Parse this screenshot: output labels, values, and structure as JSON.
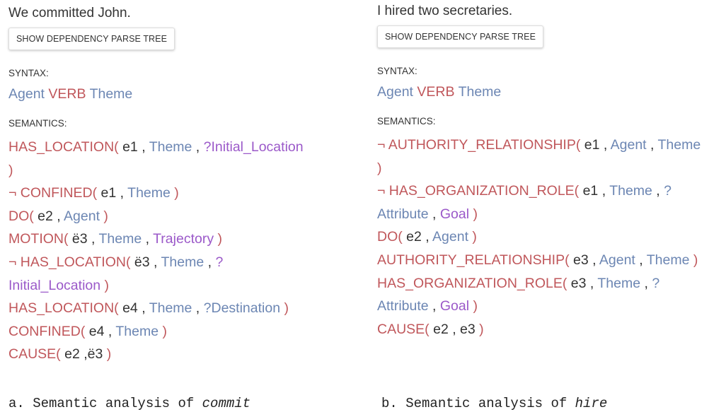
{
  "panels": [
    {
      "sentence": "We committed John.",
      "button_label": "SHOW DEPENDENCY PARSE TREE",
      "syntax_label": "SYNTAX:",
      "semantics_label": "SEMANTICS:"
    },
    {
      "sentence": "I hired two secretaries.",
      "button_label": "SHOW DEPENDENCY PARSE TREE",
      "syntax_label": "SYNTAX:",
      "semantics_label": "SEMANTICS:"
    }
  ],
  "syntax_tokens": [
    "Agent",
    "VERB",
    "Theme"
  ],
  "captions": [
    {
      "prefix": "a. Semantic analysis of ",
      "word": "commit"
    },
    {
      "prefix": "b. Semantic analysis of ",
      "word": "hire"
    }
  ],
  "semantics": [
    [
      [
        [
          "c-pred",
          "HAS_LOCATION("
        ],
        [
          "c-arg",
          " e1"
        ],
        [
          "c-arg",
          " ,"
        ],
        [
          "c-role",
          " Theme"
        ],
        [
          "c-arg",
          " ,"
        ],
        [
          "c-q",
          " ?Initial_Location"
        ]
      ],
      [
        [
          "c-paren",
          ")"
        ]
      ],
      [
        [
          "c-pred",
          "¬ CONFINED("
        ],
        [
          "c-arg",
          " e1"
        ],
        [
          "c-arg",
          " ,"
        ],
        [
          "c-role",
          " Theme"
        ],
        [
          "c-paren",
          " )"
        ]
      ],
      [
        [
          "c-pred",
          "DO("
        ],
        [
          "c-arg",
          " e2"
        ],
        [
          "c-arg",
          " ,"
        ],
        [
          "c-role",
          " Agent"
        ],
        [
          "c-paren",
          " )"
        ]
      ],
      [
        [
          "c-pred",
          "MOTION("
        ],
        [
          "c-arg",
          " ë3"
        ],
        [
          "c-arg",
          " ,"
        ],
        [
          "c-role",
          " Theme"
        ],
        [
          "c-arg",
          " ,"
        ],
        [
          "c-q",
          " Trajectory"
        ],
        [
          "c-paren",
          " )"
        ]
      ],
      [
        [
          "c-pred",
          "¬ HAS_LOCATION("
        ],
        [
          "c-arg",
          " ë3"
        ],
        [
          "c-arg",
          " ,"
        ],
        [
          "c-role",
          " Theme"
        ],
        [
          "c-arg",
          " ,"
        ],
        [
          "c-q",
          " ?"
        ]
      ],
      [
        [
          "c-q",
          "Initial_Location"
        ],
        [
          "c-paren",
          " )"
        ]
      ],
      [
        [
          "c-pred",
          "HAS_LOCATION("
        ],
        [
          "c-arg",
          " e4"
        ],
        [
          "c-arg",
          " ,"
        ],
        [
          "c-role",
          " Theme"
        ],
        [
          "c-arg",
          " ,"
        ],
        [
          "c-role",
          " ?Destination"
        ],
        [
          "c-paren",
          " )"
        ]
      ],
      [
        [
          "c-pred",
          "CONFINED("
        ],
        [
          "c-arg",
          " e4"
        ],
        [
          "c-arg",
          " ,"
        ],
        [
          "c-role",
          " Theme"
        ],
        [
          "c-paren",
          " )"
        ]
      ],
      [
        [
          "c-pred",
          "CAUSE("
        ],
        [
          "c-arg",
          " e2"
        ],
        [
          "c-arg",
          " ,"
        ],
        [
          "c-arg",
          "ë3"
        ],
        [
          "c-paren",
          " )"
        ]
      ]
    ],
    [
      [
        [
          "c-pred",
          "¬ AUTHORITY_RELATIONSHIP("
        ],
        [
          "c-arg",
          " e1"
        ],
        [
          "c-arg",
          " ,"
        ],
        [
          "c-role",
          " Agent"
        ],
        [
          "c-arg",
          " ,"
        ],
        [
          "c-role",
          " Theme"
        ]
      ],
      [
        [
          "c-paren",
          ")"
        ]
      ],
      [
        [
          "c-pred",
          "¬ HAS_ORGANIZATION_ROLE("
        ],
        [
          "c-arg",
          " e1"
        ],
        [
          "c-arg",
          " ,"
        ],
        [
          "c-role",
          " Theme"
        ],
        [
          "c-arg",
          " ,"
        ],
        [
          "c-role",
          " ?"
        ]
      ],
      [
        [
          "c-role",
          "Attribute"
        ],
        [
          "c-arg",
          " ,"
        ],
        [
          "c-q",
          " Goal"
        ],
        [
          "c-paren",
          " )"
        ]
      ],
      [
        [
          "c-pred",
          "DO("
        ],
        [
          "c-arg",
          " e2"
        ],
        [
          "c-arg",
          " ,"
        ],
        [
          "c-role",
          " Agent"
        ],
        [
          "c-paren",
          " )"
        ]
      ],
      [
        [
          "c-pred",
          "AUTHORITY_RELATIONSHIP("
        ],
        [
          "c-arg",
          " e3"
        ],
        [
          "c-arg",
          " ,"
        ],
        [
          "c-role",
          " Agent"
        ],
        [
          "c-arg",
          " ,"
        ],
        [
          "c-role",
          " Theme"
        ],
        [
          "c-paren",
          " )"
        ]
      ],
      [
        [
          "c-pred",
          "HAS_ORGANIZATION_ROLE("
        ],
        [
          "c-arg",
          " e3"
        ],
        [
          "c-arg",
          " ,"
        ],
        [
          "c-role",
          " Theme"
        ],
        [
          "c-arg",
          " ,"
        ],
        [
          "c-role",
          " ?"
        ]
      ],
      [
        [
          "c-role",
          "Attribute"
        ],
        [
          "c-arg",
          " ,"
        ],
        [
          "c-q",
          " Goal"
        ],
        [
          "c-paren",
          " )"
        ]
      ],
      [
        [
          "c-pred",
          "CAUSE("
        ],
        [
          "c-arg",
          " e2"
        ],
        [
          "c-arg",
          " ,"
        ],
        [
          "c-arg",
          " e3"
        ],
        [
          "c-paren",
          " )"
        ]
      ]
    ]
  ]
}
